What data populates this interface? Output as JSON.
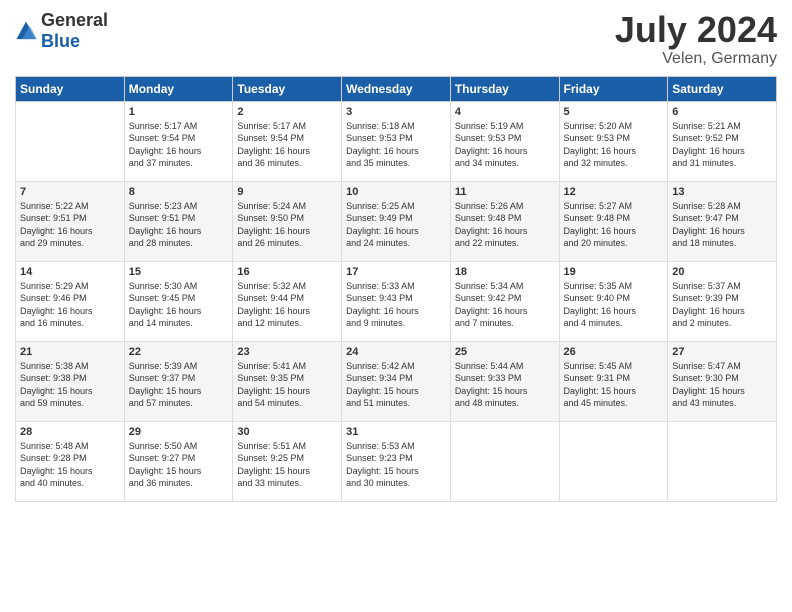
{
  "logo": {
    "general": "General",
    "blue": "Blue"
  },
  "title": {
    "month_year": "July 2024",
    "location": "Velen, Germany"
  },
  "headers": [
    "Sunday",
    "Monday",
    "Tuesday",
    "Wednesday",
    "Thursday",
    "Friday",
    "Saturday"
  ],
  "weeks": [
    [
      {
        "day": "",
        "info": ""
      },
      {
        "day": "1",
        "info": "Sunrise: 5:17 AM\nSunset: 9:54 PM\nDaylight: 16 hours\nand 37 minutes."
      },
      {
        "day": "2",
        "info": "Sunrise: 5:17 AM\nSunset: 9:54 PM\nDaylight: 16 hours\nand 36 minutes."
      },
      {
        "day": "3",
        "info": "Sunrise: 5:18 AM\nSunset: 9:53 PM\nDaylight: 16 hours\nand 35 minutes."
      },
      {
        "day": "4",
        "info": "Sunrise: 5:19 AM\nSunset: 9:53 PM\nDaylight: 16 hours\nand 34 minutes."
      },
      {
        "day": "5",
        "info": "Sunrise: 5:20 AM\nSunset: 9:53 PM\nDaylight: 16 hours\nand 32 minutes."
      },
      {
        "day": "6",
        "info": "Sunrise: 5:21 AM\nSunset: 9:52 PM\nDaylight: 16 hours\nand 31 minutes."
      }
    ],
    [
      {
        "day": "7",
        "info": "Sunrise: 5:22 AM\nSunset: 9:51 PM\nDaylight: 16 hours\nand 29 minutes."
      },
      {
        "day": "8",
        "info": "Sunrise: 5:23 AM\nSunset: 9:51 PM\nDaylight: 16 hours\nand 28 minutes."
      },
      {
        "day": "9",
        "info": "Sunrise: 5:24 AM\nSunset: 9:50 PM\nDaylight: 16 hours\nand 26 minutes."
      },
      {
        "day": "10",
        "info": "Sunrise: 5:25 AM\nSunset: 9:49 PM\nDaylight: 16 hours\nand 24 minutes."
      },
      {
        "day": "11",
        "info": "Sunrise: 5:26 AM\nSunset: 9:48 PM\nDaylight: 16 hours\nand 22 minutes."
      },
      {
        "day": "12",
        "info": "Sunrise: 5:27 AM\nSunset: 9:48 PM\nDaylight: 16 hours\nand 20 minutes."
      },
      {
        "day": "13",
        "info": "Sunrise: 5:28 AM\nSunset: 9:47 PM\nDaylight: 16 hours\nand 18 minutes."
      }
    ],
    [
      {
        "day": "14",
        "info": "Sunrise: 5:29 AM\nSunset: 9:46 PM\nDaylight: 16 hours\nand 16 minutes."
      },
      {
        "day": "15",
        "info": "Sunrise: 5:30 AM\nSunset: 9:45 PM\nDaylight: 16 hours\nand 14 minutes."
      },
      {
        "day": "16",
        "info": "Sunrise: 5:32 AM\nSunset: 9:44 PM\nDaylight: 16 hours\nand 12 minutes."
      },
      {
        "day": "17",
        "info": "Sunrise: 5:33 AM\nSunset: 9:43 PM\nDaylight: 16 hours\nand 9 minutes."
      },
      {
        "day": "18",
        "info": "Sunrise: 5:34 AM\nSunset: 9:42 PM\nDaylight: 16 hours\nand 7 minutes."
      },
      {
        "day": "19",
        "info": "Sunrise: 5:35 AM\nSunset: 9:40 PM\nDaylight: 16 hours\nand 4 minutes."
      },
      {
        "day": "20",
        "info": "Sunrise: 5:37 AM\nSunset: 9:39 PM\nDaylight: 16 hours\nand 2 minutes."
      }
    ],
    [
      {
        "day": "21",
        "info": "Sunrise: 5:38 AM\nSunset: 9:38 PM\nDaylight: 15 hours\nand 59 minutes."
      },
      {
        "day": "22",
        "info": "Sunrise: 5:39 AM\nSunset: 9:37 PM\nDaylight: 15 hours\nand 57 minutes."
      },
      {
        "day": "23",
        "info": "Sunrise: 5:41 AM\nSunset: 9:35 PM\nDaylight: 15 hours\nand 54 minutes."
      },
      {
        "day": "24",
        "info": "Sunrise: 5:42 AM\nSunset: 9:34 PM\nDaylight: 15 hours\nand 51 minutes."
      },
      {
        "day": "25",
        "info": "Sunrise: 5:44 AM\nSunset: 9:33 PM\nDaylight: 15 hours\nand 48 minutes."
      },
      {
        "day": "26",
        "info": "Sunrise: 5:45 AM\nSunset: 9:31 PM\nDaylight: 15 hours\nand 45 minutes."
      },
      {
        "day": "27",
        "info": "Sunrise: 5:47 AM\nSunset: 9:30 PM\nDaylight: 15 hours\nand 43 minutes."
      }
    ],
    [
      {
        "day": "28",
        "info": "Sunrise: 5:48 AM\nSunset: 9:28 PM\nDaylight: 15 hours\nand 40 minutes."
      },
      {
        "day": "29",
        "info": "Sunrise: 5:50 AM\nSunset: 9:27 PM\nDaylight: 15 hours\nand 36 minutes."
      },
      {
        "day": "30",
        "info": "Sunrise: 5:51 AM\nSunset: 9:25 PM\nDaylight: 15 hours\nand 33 minutes."
      },
      {
        "day": "31",
        "info": "Sunrise: 5:53 AM\nSunset: 9:23 PM\nDaylight: 15 hours\nand 30 minutes."
      },
      {
        "day": "",
        "info": ""
      },
      {
        "day": "",
        "info": ""
      },
      {
        "day": "",
        "info": ""
      }
    ]
  ]
}
